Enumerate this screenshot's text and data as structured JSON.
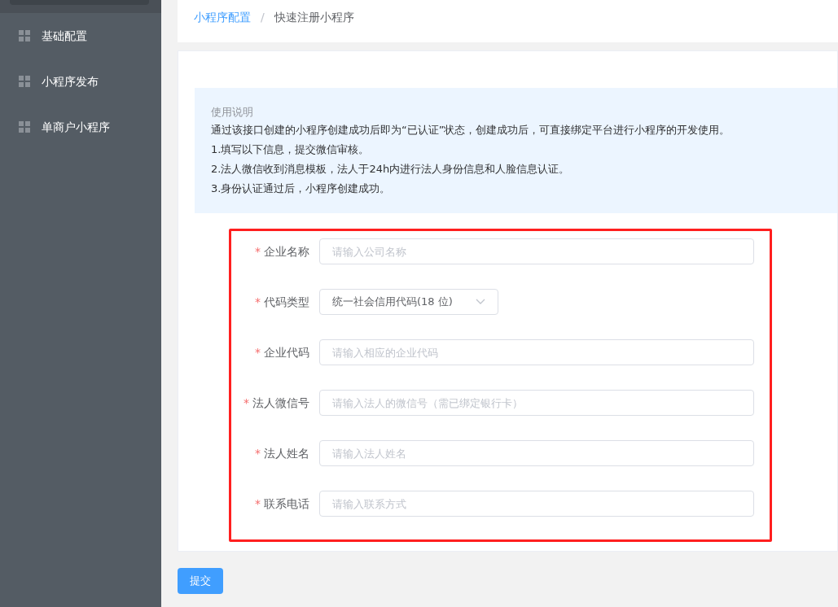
{
  "sidebar": {
    "items": [
      {
        "label": "基础配置",
        "selected": false
      },
      {
        "label": "小程序发布",
        "selected": false
      },
      {
        "label": "单商户小程序",
        "selected": false
      }
    ]
  },
  "breadcrumb": [
    {
      "label": "小程序配置",
      "kind": "link"
    },
    {
      "label": "/",
      "kind": "separator"
    },
    {
      "label": "快速注册小程序",
      "kind": "current"
    }
  ],
  "notice": {
    "title": "使用说明",
    "lines": [
      "通过该接口创建的小程序创建成功后即为“已认证”状态，创建成功后，可直接绑定平台进行小程序的开发使用。",
      "1.填写以下信息，提交微信审核。",
      "2.法人微信收到消息模板，法人于24h内进行法人身份信息和人脸信息认证。",
      "3.身份认证通过后，小程序创建成功。"
    ]
  },
  "form": {
    "highlighted": true,
    "fields": [
      {
        "label": "企业名称",
        "required_mark": "*",
        "kind": "input",
        "placeholder": "请输入公司名称"
      },
      {
        "label": "代码类型",
        "required_mark": "*",
        "kind": "select",
        "value": "统一社会信用代码(18 位)"
      },
      {
        "label": "企业代码",
        "required_mark": "*",
        "kind": "input",
        "placeholder": "请输入相应的企业代码"
      },
      {
        "label": "法人微信号",
        "required_mark": "*",
        "kind": "input",
        "placeholder": "请输入法人的微信号（需已绑定银行卡）"
      },
      {
        "label": "法人姓名",
        "required_mark": "*",
        "kind": "input",
        "placeholder": "请输入法人姓名"
      },
      {
        "label": "联系电话",
        "required_mark": "*",
        "kind": "input",
        "placeholder": "请输入联系方式"
      }
    ]
  },
  "submit_button": "提交"
}
